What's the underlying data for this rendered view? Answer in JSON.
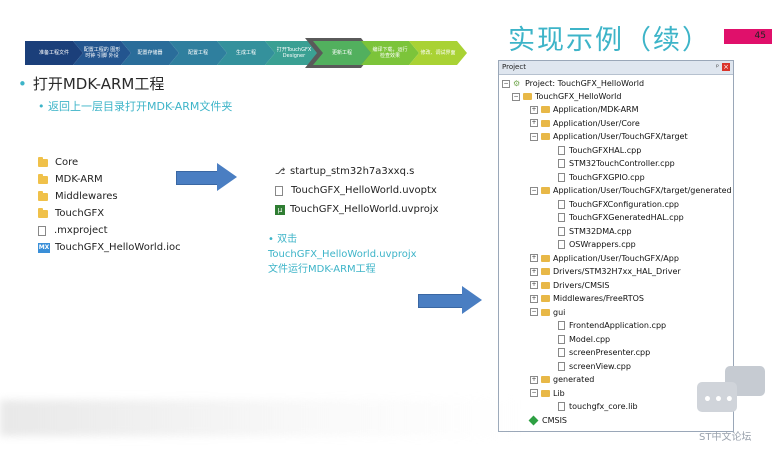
{
  "process_steps": [
    {
      "label": "准备工程文件",
      "color": "#1b3f7a"
    },
    {
      "label": "配置工程的 图形 时钟 引脚 外设",
      "color": "#23558f"
    },
    {
      "label": "配置存储器",
      "color": "#2a6d9a"
    },
    {
      "label": "配置工程",
      "color": "#2f7f9e"
    },
    {
      "label": "生成工程",
      "color": "#34919c"
    },
    {
      "label": "打开TouchGFX Designer",
      "color": "#3aa093"
    },
    {
      "label": "更新工程",
      "color": "#52b05e"
    },
    {
      "label": "编译下载，运行 检查效果",
      "color": "#7cc43a"
    },
    {
      "label": "修改、调试界面",
      "color": "#a9d234"
    }
  ],
  "slide": {
    "title": "实现示例（续）",
    "page_number": "45",
    "bullet_main": "打开MDK-ARM工程",
    "bullet_sub": "返回上一层目录打开MDK-ARM文件夹",
    "note_line1": "双击",
    "note_line2": "TouchGFX_HelloWorld.uvprojx",
    "note_line3": "文件运行MDK-ARM工程"
  },
  "project_folder": [
    {
      "name": "Core",
      "icon": "folder-icon"
    },
    {
      "name": "MDK-ARM",
      "icon": "folder-icon"
    },
    {
      "name": "Middlewares",
      "icon": "folder-icon"
    },
    {
      "name": "TouchGFX",
      "icon": "folder-icon"
    },
    {
      "name": ".mxproject",
      "icon": "file-icon"
    },
    {
      "name": "TouchGFX_HelloWorld.ioc",
      "icon": "mx-icon"
    }
  ],
  "mdk_folder": [
    {
      "name": "startup_stm32h7a3xxq.s",
      "icon": "asm-file-icon"
    },
    {
      "name": "TouchGFX_HelloWorld.uvoptx",
      "icon": "file-icon"
    },
    {
      "name": "TouchGFX_HelloWorld.uvprojx",
      "icon": "uvision-project-icon"
    }
  ],
  "project_panel": {
    "header": "Project",
    "pin": "ᵖ",
    "close": "×",
    "root": "Project: TouchGFX_HelloWorld",
    "target": "TouchGFX_HelloWorld",
    "items": [
      {
        "label": "Application/MDK-ARM",
        "kind": "folder",
        "exp": "+"
      },
      {
        "label": "Application/User/Core",
        "kind": "folder",
        "exp": "+"
      },
      {
        "label": "Application/User/TouchGFX/target",
        "kind": "folder",
        "exp": "−"
      },
      {
        "label": "TouchGFXHAL.cpp",
        "kind": "file"
      },
      {
        "label": "STM32TouchController.cpp",
        "kind": "file"
      },
      {
        "label": "TouchGFXGPIO.cpp",
        "kind": "file"
      },
      {
        "label": "Application/User/TouchGFX/target/generated",
        "kind": "folder",
        "exp": "−"
      },
      {
        "label": "TouchGFXConfiguration.cpp",
        "kind": "file"
      },
      {
        "label": "TouchGFXGeneratedHAL.cpp",
        "kind": "file"
      },
      {
        "label": "STM32DMA.cpp",
        "kind": "file"
      },
      {
        "label": "OSWrappers.cpp",
        "kind": "file"
      },
      {
        "label": "Application/User/TouchGFX/App",
        "kind": "folder",
        "exp": "+"
      },
      {
        "label": "Drivers/STM32H7xx_HAL_Driver",
        "kind": "folder",
        "exp": "+"
      },
      {
        "label": "Drivers/CMSIS",
        "kind": "folder",
        "exp": "+"
      },
      {
        "label": "Middlewares/FreeRTOS",
        "kind": "folder",
        "exp": "+"
      },
      {
        "label": "gui",
        "kind": "folder",
        "exp": "−"
      },
      {
        "label": "FrontendApplication.cpp",
        "kind": "file"
      },
      {
        "label": "Model.cpp",
        "kind": "file"
      },
      {
        "label": "screenPresenter.cpp",
        "kind": "file"
      },
      {
        "label": "screenView.cpp",
        "kind": "file"
      },
      {
        "label": "generated",
        "kind": "folder",
        "exp": "+"
      },
      {
        "label": "Lib",
        "kind": "folder",
        "exp": "−"
      },
      {
        "label": "touchgfx_core.lib",
        "kind": "file"
      },
      {
        "label": "CMSIS",
        "kind": "component"
      }
    ]
  },
  "watermark": {
    "dots": "•••",
    "text": "ST中文论坛"
  }
}
